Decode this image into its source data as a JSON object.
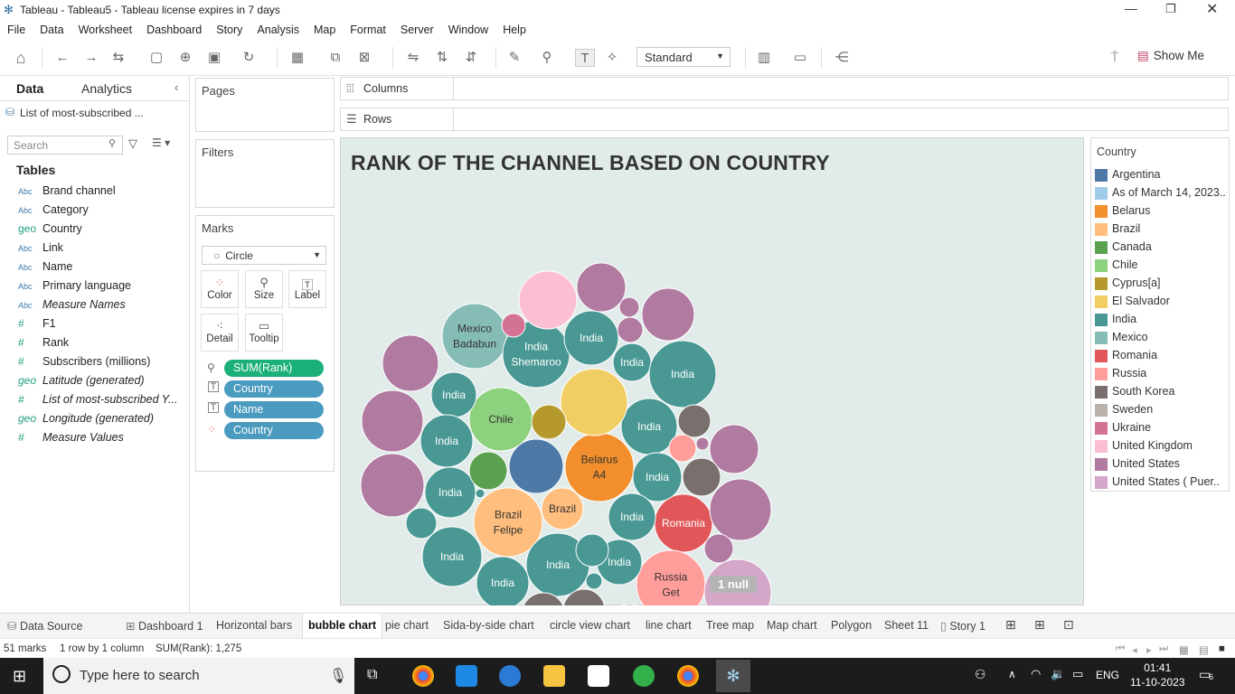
{
  "window": {
    "title": "Tableau - Tableau5 - Tableau license expires in 7 days"
  },
  "menu": [
    "File",
    "Data",
    "Worksheet",
    "Dashboard",
    "Story",
    "Analysis",
    "Map",
    "Format",
    "Server",
    "Window",
    "Help"
  ],
  "toolbar": {
    "fit_value": "Standard",
    "show_me": "Show Me"
  },
  "left": {
    "tab_data": "Data",
    "tab_analytics": "Analytics",
    "datasource": "List of most-subscribed ...",
    "search_placeholder": "Search",
    "tables_heading": "Tables",
    "fields": [
      {
        "type": "Abc",
        "name": "Brand channel",
        "italic": false
      },
      {
        "type": "Abc",
        "name": "Category",
        "italic": false
      },
      {
        "type": "geo",
        "name": "Country",
        "italic": false
      },
      {
        "type": "Abc",
        "name": "Link",
        "italic": false
      },
      {
        "type": "Abc",
        "name": "Name",
        "italic": false
      },
      {
        "type": "Abc",
        "name": "Primary language",
        "italic": false
      },
      {
        "type": "Abc",
        "name": "Measure Names",
        "italic": true
      },
      {
        "type": "#",
        "name": "F1",
        "italic": false
      },
      {
        "type": "#",
        "name": "Rank",
        "italic": false
      },
      {
        "type": "#",
        "name": "Subscribers (millions)",
        "italic": false
      },
      {
        "type": "geo",
        "name": "Latitude (generated)",
        "italic": true
      },
      {
        "type": "#",
        "name": "List of most-subscribed Y...",
        "italic": true
      },
      {
        "type": "geo",
        "name": "Longitude (generated)",
        "italic": true
      },
      {
        "type": "#",
        "name": "Measure Values",
        "italic": true
      }
    ]
  },
  "shelves": {
    "pages": "Pages",
    "filters": "Filters",
    "marks": "Marks",
    "columns": "Columns",
    "rows": "Rows",
    "mark_type": "Circle",
    "mark_buttons": [
      "Color",
      "Size",
      "Label",
      "Detail",
      "Tooltip"
    ],
    "pills": [
      {
        "label": "SUM(Rank)",
        "color": "#1bb07a"
      },
      {
        "label": "Country",
        "color": "#4a9bbf"
      },
      {
        "label": "Name",
        "color": "#4a9bbf"
      },
      {
        "label": "Country",
        "color": "#4a9bbf"
      }
    ]
  },
  "view": {
    "title": "RANK OF THE CHANNEL BASED ON COUNTRY",
    "null_badge": "1 null"
  },
  "legend": {
    "title": "Country",
    "items": [
      {
        "label": "Argentina",
        "color": "#4e79a7"
      },
      {
        "label": "As of March 14, 2023..",
        "color": "#a0cbe8"
      },
      {
        "label": "Belarus",
        "color": "#f28e2b"
      },
      {
        "label": "Brazil",
        "color": "#ffbe7d"
      },
      {
        "label": "Canada",
        "color": "#59a14f"
      },
      {
        "label": "Chile",
        "color": "#8cd17d"
      },
      {
        "label": "Cyprus[a]",
        "color": "#b6992d"
      },
      {
        "label": "El Salvador",
        "color": "#f1ce63"
      },
      {
        "label": "India",
        "color": "#499894"
      },
      {
        "label": "Mexico",
        "color": "#86bcb6"
      },
      {
        "label": "Romania",
        "color": "#e15759"
      },
      {
        "label": "Russia",
        "color": "#ff9d9a"
      },
      {
        "label": "South Korea",
        "color": "#79706e"
      },
      {
        "label": "Sweden",
        "color": "#bab0ac"
      },
      {
        "label": "Ukraine",
        "color": "#d37295"
      },
      {
        "label": "United Kingdom",
        "color": "#fabfd2"
      },
      {
        "label": "United States",
        "color": "#b07aa1"
      },
      {
        "label": "United States ( Puer..",
        "color": "#d4a6c8"
      }
    ]
  },
  "chart_data": {
    "type": "bubble",
    "title": "RANK OF THE CHANNEL BASED ON COUNTRY",
    "size_measure": "SUM(Rank)",
    "marks_count": 51,
    "total": 1275,
    "labeled_bubbles": [
      {
        "country": "Mexico",
        "label": "Mexico Badabun"
      },
      {
        "country": "India",
        "label": "India Shemaroo"
      },
      {
        "country": "Chile",
        "label": "Chile"
      },
      {
        "country": "Belarus",
        "label": "Belarus A4"
      },
      {
        "country": "Brazil",
        "label": "Brazil Felipe"
      },
      {
        "country": "Brazil",
        "label": "Brazil"
      },
      {
        "country": "Romania",
        "label": "Romania"
      },
      {
        "country": "Russia",
        "label": "Russia Get"
      },
      {
        "country": "India",
        "label": "India"
      }
    ]
  },
  "sheets": [
    "Data Source",
    "Dashboard 1",
    "Horizontal bars",
    "bubble chart",
    "pie chart",
    "Sida-by-side chart",
    "circle view chart",
    "line chart",
    "Tree map",
    "Map chart",
    "Polygon",
    "Sheet 11",
    "Story 1"
  ],
  "active_sheet": "bubble chart",
  "status": {
    "marks": "51 marks",
    "dims": "1 row by 1 column",
    "sum": "SUM(Rank): 1,275"
  },
  "taskbar": {
    "search_placeholder": "Type here to search",
    "lang": "ENG",
    "time": "01:41",
    "date": "11-10-2023",
    "notif": "6"
  }
}
